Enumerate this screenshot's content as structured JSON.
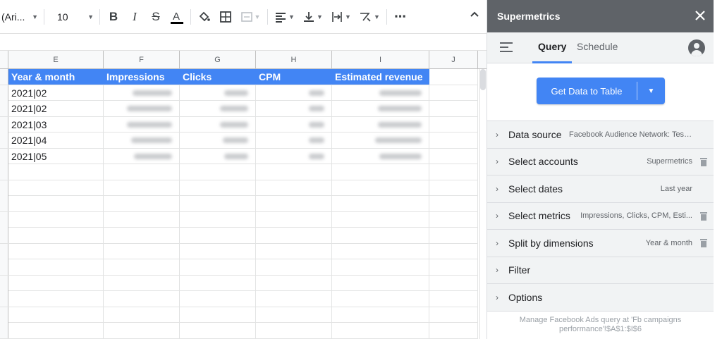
{
  "toolbar": {
    "font_name": "(Ari...",
    "font_size": "10",
    "more_label": "⋯"
  },
  "columns": [
    "E",
    "F",
    "G",
    "H",
    "I",
    "J"
  ],
  "table": {
    "headers": [
      "Year & month",
      "Impressions",
      "Clicks",
      "CPM",
      "Estimated revenue"
    ],
    "rows": [
      [
        "2021|02"
      ],
      [
        "2021|02"
      ],
      [
        "2021|03"
      ],
      [
        "2021|04"
      ],
      [
        "2021|05"
      ]
    ]
  },
  "panel": {
    "title": "Supermetrics",
    "tabs": {
      "query": "Query",
      "schedule": "Schedule"
    },
    "get_data_label": "Get Data to Table",
    "sections": [
      {
        "label": "Data source",
        "value": "Facebook Audience Network: Test..."
      },
      {
        "label": "Select accounts",
        "value": "Supermetrics"
      },
      {
        "label": "Select dates",
        "value": "Last year"
      },
      {
        "label": "Select metrics",
        "value": "Impressions, Clicks, CPM, Esti..."
      },
      {
        "label": "Split by dimensions",
        "value": "Year & month"
      },
      {
        "label": "Filter",
        "value": ""
      },
      {
        "label": "Options",
        "value": ""
      }
    ],
    "footer": "Manage Facebook Ads query at 'Fb campaigns performance'!$A$1:$I$6"
  },
  "colors": {
    "header_blue": "#4285f4",
    "panel_title_bg": "#5f6368",
    "panel_bg": "#f1f3f4"
  }
}
